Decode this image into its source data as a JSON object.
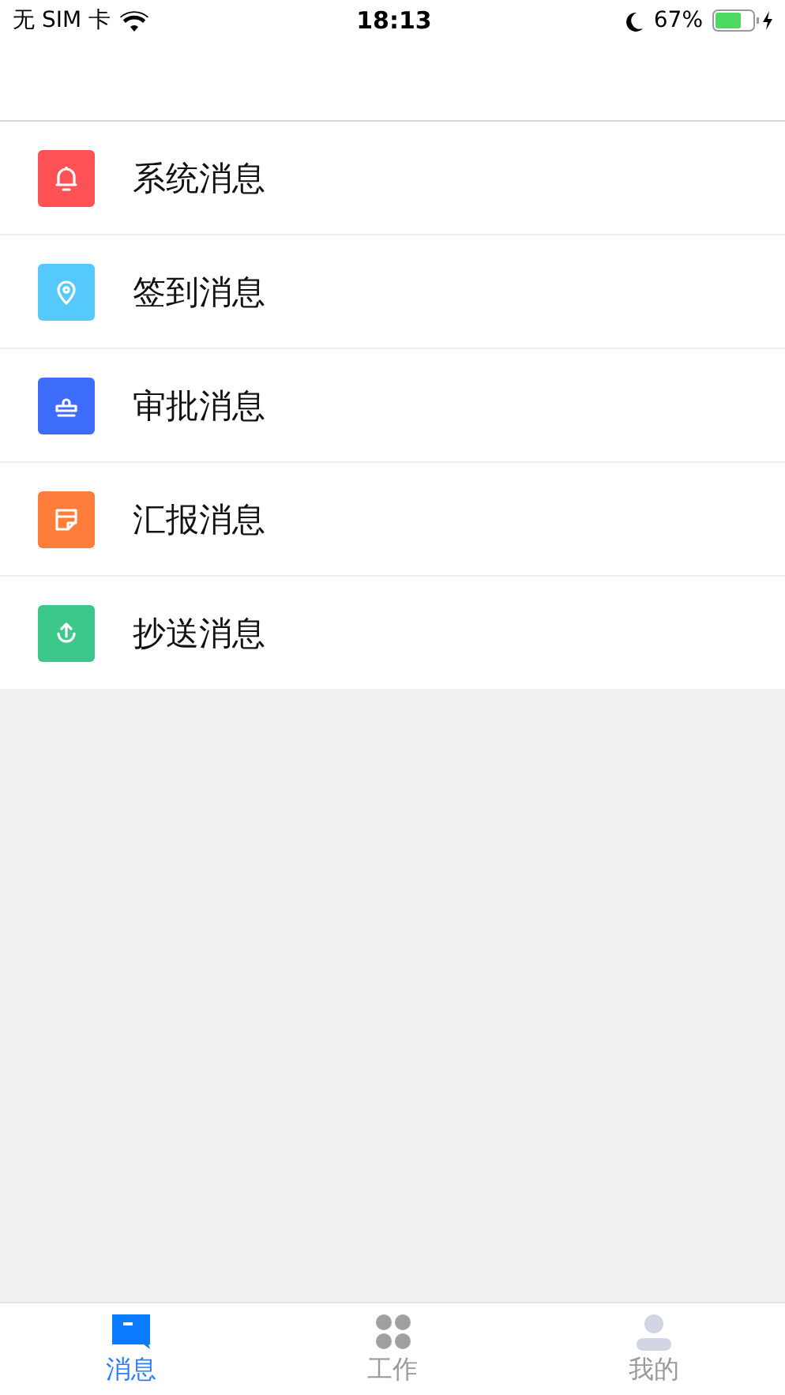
{
  "status_bar": {
    "carrier": "无 SIM 卡",
    "time": "18:13",
    "battery": "67%"
  },
  "messages": [
    {
      "label": "系统消息",
      "kind": "bell",
      "color": "#fe5257"
    },
    {
      "label": "签到消息",
      "kind": "pin",
      "color": "#55c8fc"
    },
    {
      "label": "审批消息",
      "kind": "stamp",
      "color": "#3d6cfb"
    },
    {
      "label": "汇报消息",
      "kind": "note",
      "color": "#ff7d3a"
    },
    {
      "label": "抄送消息",
      "kind": "upload",
      "color": "#3cc88a"
    }
  ],
  "tabs": [
    {
      "label": "消息",
      "kind": "chat",
      "selected": true
    },
    {
      "label": "工作",
      "kind": "grid",
      "selected": false
    },
    {
      "label": "我的",
      "kind": "person",
      "selected": false
    }
  ]
}
